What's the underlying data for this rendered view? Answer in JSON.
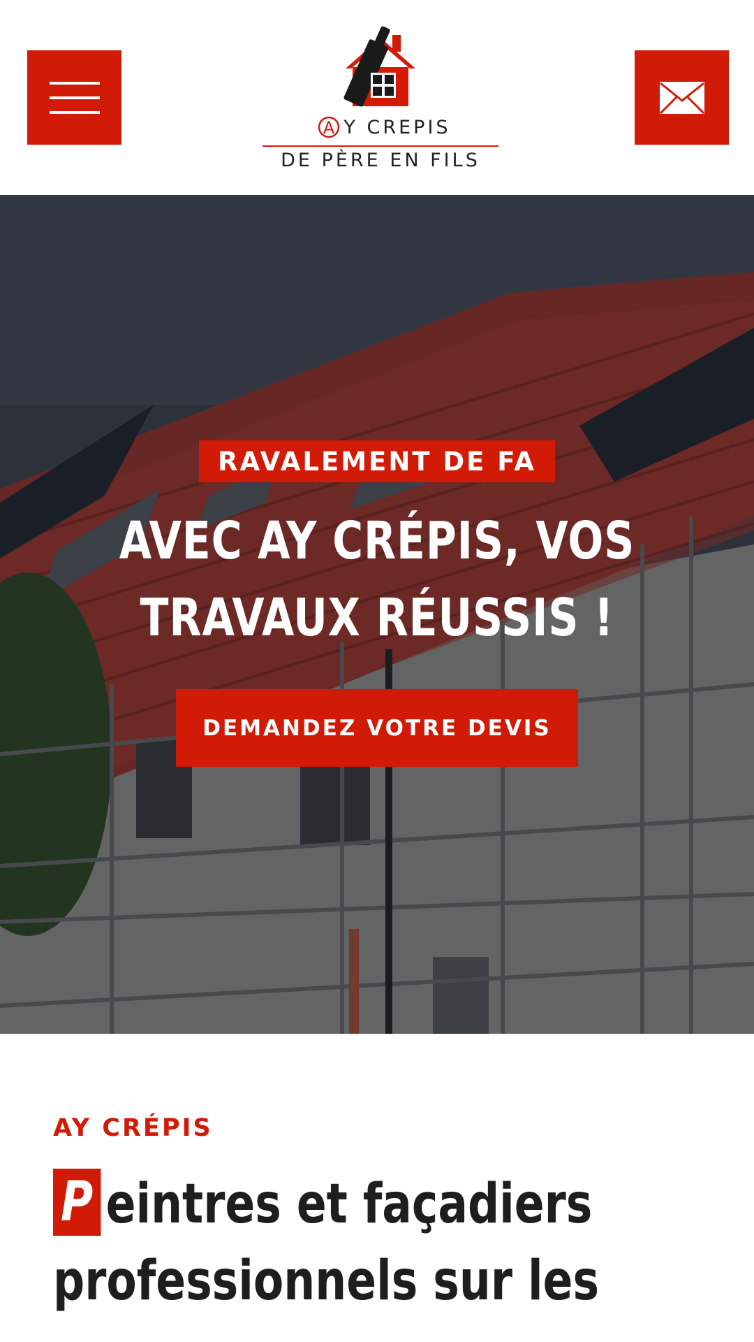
{
  "header": {
    "menu_label": "Menu",
    "mail_label": "Contact",
    "logo": {
      "line1": "Y CREPIS",
      "letter": "A",
      "line2": "DE PÈRE EN FILS"
    }
  },
  "hero": {
    "badge": "RAVALEMENT DE FA",
    "title": "AVEC AY CRÉPIS, VOS TRAVAUX RÉUSSIS !",
    "cta": "DEMANDEZ VOTRE DEVIS"
  },
  "intro": {
    "eyebrow": "AY CRÉPIS",
    "title_first_letter": "P",
    "title_rest": "eintres et façadiers professionnels sur les"
  },
  "colors": {
    "accent": "#d11b06",
    "text": "#1e1e1e",
    "background": "#ffffff"
  },
  "icons": [
    "menu-icon",
    "mail-icon",
    "logo-house-icon"
  ]
}
